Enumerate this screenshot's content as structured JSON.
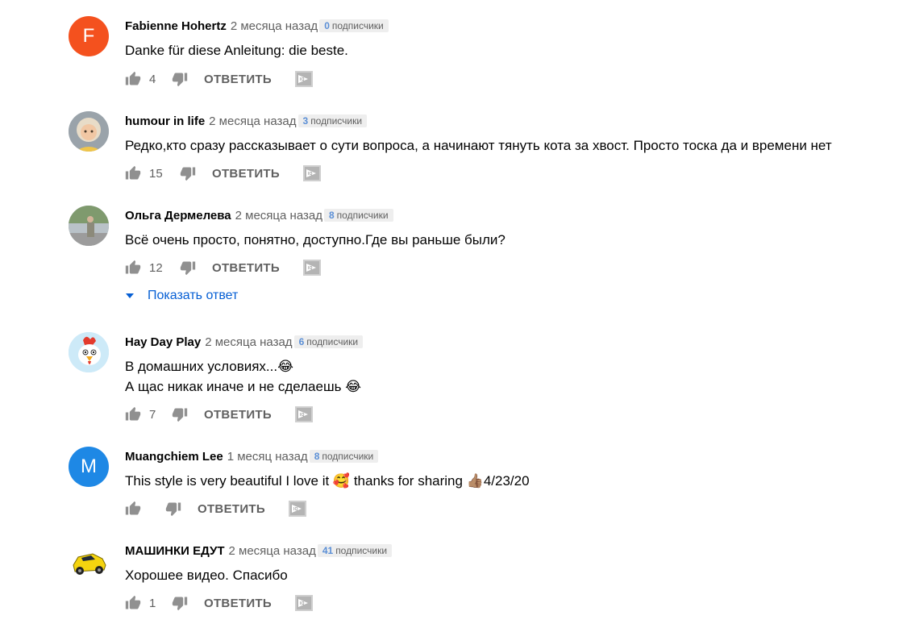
{
  "comments": [
    {
      "author": "Fabienne Hohertz",
      "time": "2 месяца назад",
      "subs_count": "0",
      "subs_label": "подписчики",
      "lines": [
        "Danke für diese Anleitung: die beste."
      ],
      "likes": "4",
      "reply_label": "ОТВЕТИТЬ",
      "avatar_letter": "F",
      "avatar_color": "#f4511e"
    },
    {
      "author": "humour in life",
      "time": "2 месяца назад",
      "subs_count": "3",
      "subs_label": "подписчики",
      "lines": [
        "Редко,кто сразу рассказывает о сути вопроса, а начинают тянуть кота за хвост. Просто тоска да и времени нет"
      ],
      "likes": "15",
      "reply_label": "ОТВЕТИТЬ"
    },
    {
      "author": "Ольга Дермелева",
      "time": "2 месяца назад",
      "subs_count": "8",
      "subs_label": "подписчики",
      "lines": [
        "Всё очень просто, понятно, доступно.Где вы раньше были?"
      ],
      "likes": "12",
      "reply_label": "ОТВЕТИТЬ",
      "show_replies": "Показать ответ"
    },
    {
      "author": "Hay Day Play",
      "time": "2 месяца назад",
      "subs_count": "6",
      "subs_label": "подписчики",
      "lines": [
        "В домашних условиях...😂",
        "А щас никак иначе и не сделаешь 😂"
      ],
      "likes": "7",
      "reply_label": "ОТВЕТИТЬ"
    },
    {
      "author": "Muangchiem Lee",
      "time": "1 месяц назад",
      "subs_count": "8",
      "subs_label": "подписчики",
      "lines": [
        "This style is very beautiful I love it 🥰 thanks for sharing 👍🏽4/23/20"
      ],
      "likes": "",
      "reply_label": "ОТВЕТИТЬ",
      "avatar_letter": "M",
      "avatar_color": "#1e88e5"
    },
    {
      "author": "МАШИНКИ ЕДУТ",
      "time": "2 месяца назад",
      "subs_count": "41",
      "subs_label": "подписчики",
      "lines": [
        "Хорошее видео. Спасибо"
      ],
      "likes": "1",
      "reply_label": "ОТВЕТИТЬ"
    }
  ],
  "icons": {
    "like": "thumbs-up-icon",
    "dislike": "thumbs-down-icon",
    "badge": "translate-badge-icon",
    "chevron": "chevron-down-icon"
  }
}
